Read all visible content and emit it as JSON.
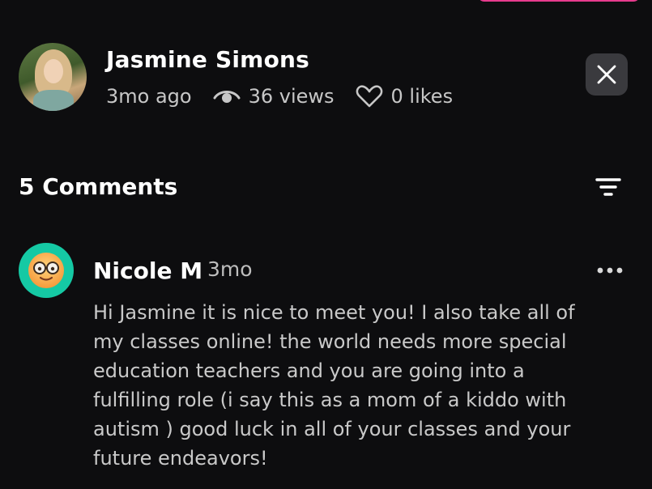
{
  "post": {
    "author_name": "Jasmine Simons",
    "time_ago": "3mo ago",
    "views": "36 views",
    "likes": "0 likes"
  },
  "comments_section": {
    "title": "5 Comments"
  },
  "comments": [
    {
      "author": "Nicole M",
      "time": "3mo",
      "text_lines": [
        "Hi Jasmine it is nice to meet you! I also take all of",
        "my classes online! the world needs more special",
        "education teachers and you are going into a",
        "fulfilling role (i say this as a mom of a kiddo with",
        "autism ) good luck in all of your classes and your",
        "future endeavors!"
      ]
    }
  ],
  "icons": {
    "views": "eye-icon",
    "likes": "heart-icon",
    "close": "close-icon",
    "sort": "filter-icon",
    "more": "more-horizontal-icon",
    "comment_avatar": "sunglasses-emoji-icon"
  },
  "colors": {
    "background": "#0d0d0f",
    "accent": "#e63b8d",
    "comment_avatar_bg": "#15c9a4",
    "muted_text": "#c9c9c9"
  }
}
